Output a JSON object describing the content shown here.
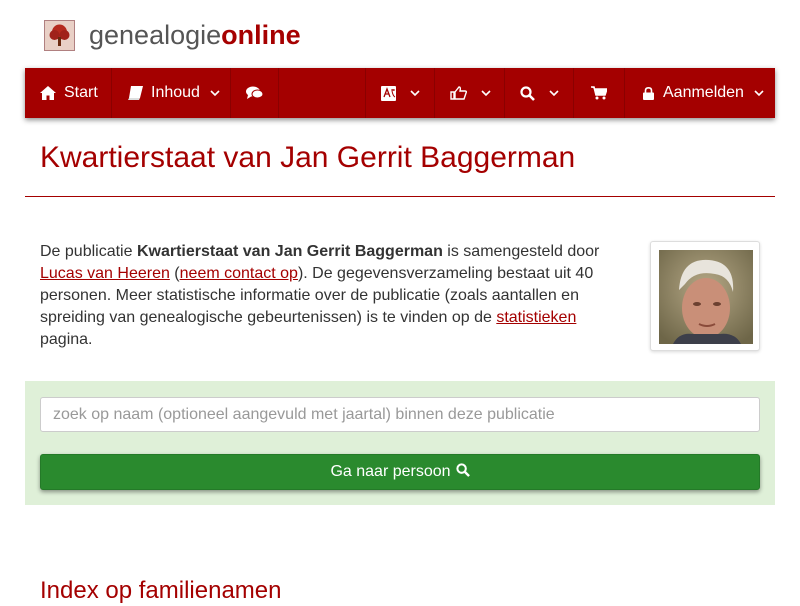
{
  "brand": {
    "part1": "genealogie",
    "part2": "online"
  },
  "nav": {
    "start_label": "Start",
    "inhoud_label": "Inhoud",
    "login_label": "Aanmelden"
  },
  "page": {
    "title": "Kwartierstaat van Jan Gerrit Baggerman",
    "intro": {
      "t1": "De publicatie ",
      "pub_name": "Kwartierstaat van Jan Gerrit Baggerman",
      "t2": " is samengesteld door ",
      "author_link": "Lucas van Heeren",
      "t3": " (",
      "contact_link": "neem contact op",
      "t4": "). De gegevensverzameling bestaat uit 40 personen. Meer statistische informatie over de publicatie (zoals aantallen en spreiding van genealogische gebeurtenissen) is te vinden op de ",
      "stats_link": "statistieken",
      "t5": " pagina."
    },
    "search": {
      "placeholder": "zoek op naam (optioneel aangevuld met jaartal) binnen deze publicatie",
      "button_label": "Ga naar persoon"
    },
    "index_heading": "Index op familienamen"
  },
  "colors": {
    "brand_red": "#a40000",
    "panel_green": "#dff0d8",
    "button_green": "#2a8a2e"
  },
  "icons": [
    "tree-logo-icon",
    "home-icon",
    "book-icon",
    "comments-icon",
    "language-icon",
    "thumbs-up-icon",
    "search-icon",
    "cart-icon",
    "lock-icon",
    "chevron-down-icon"
  ]
}
